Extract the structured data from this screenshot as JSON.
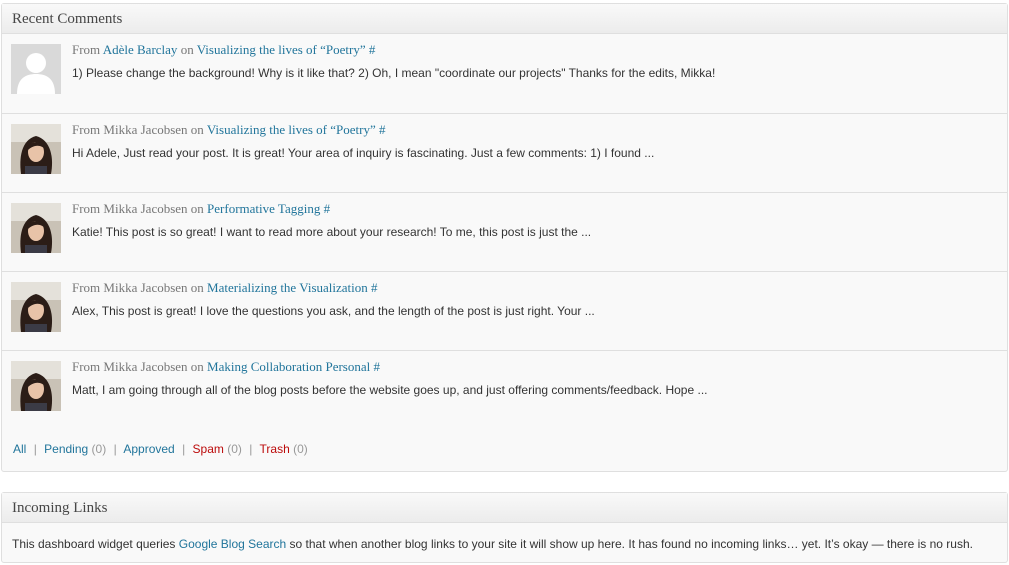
{
  "recent_comments": {
    "title": "Recent Comments",
    "comments": [
      {
        "from_label": "From",
        "author": "Adèle Barclay",
        "on_label": "on",
        "post": "Visualizing the lives of “Poetry”",
        "hash": "#",
        "excerpt": "1) Please change the background! Why is it like that? 2) Oh, I mean \"coordinate our projects\" Thanks for the edits, Mikka!",
        "avatar": "default-avatar"
      },
      {
        "from_label": "From",
        "author": "Mikka Jacobsen",
        "on_label": "on",
        "post": "Visualizing the lives of “Poetry”",
        "hash": "#",
        "excerpt": "Hi Adele, Just read your post. It is great! Your area of inquiry is fascinating. Just a few comments: 1) I found ...",
        "avatar": "photo-avatar"
      },
      {
        "from_label": "From",
        "author": "Mikka Jacobsen",
        "on_label": "on",
        "post": "Performative Tagging",
        "hash": "#",
        "excerpt": "Katie! This post is so great! I want to read more about your research! To me, this post is just the ...",
        "avatar": "photo-avatar"
      },
      {
        "from_label": "From",
        "author": "Mikka Jacobsen",
        "on_label": "on",
        "post": "Materializing the Visualization",
        "hash": "#",
        "excerpt": "Alex, This post is great! I love the questions you ask, and the length of the post is just right. Your ...",
        "avatar": "photo-avatar"
      },
      {
        "from_label": "From",
        "author": "Mikka Jacobsen",
        "on_label": "on",
        "post": "Making Collaboration Personal",
        "hash": "#",
        "excerpt": "Matt, I am going through all of the blog posts before the website goes up, and just offering comments/feedback. Hope ...",
        "avatar": "photo-avatar"
      }
    ],
    "filters": {
      "all": "All",
      "pending": "Pending",
      "pending_count": "(0)",
      "approved": "Approved",
      "spam": "Spam",
      "spam_count": "(0)",
      "trash": "Trash",
      "trash_count": "(0)",
      "separator": "|"
    }
  },
  "incoming_links": {
    "title": "Incoming Links",
    "text_before": "This dashboard widget queries ",
    "link": "Google Blog Search",
    "text_after": " so that when another blog links to your site it will show up here. It has found no incoming links… yet. It’s okay — there is no rush."
  },
  "colors": {
    "link": "#21759b",
    "danger": "#bc0b0b",
    "muted": "#777777"
  }
}
